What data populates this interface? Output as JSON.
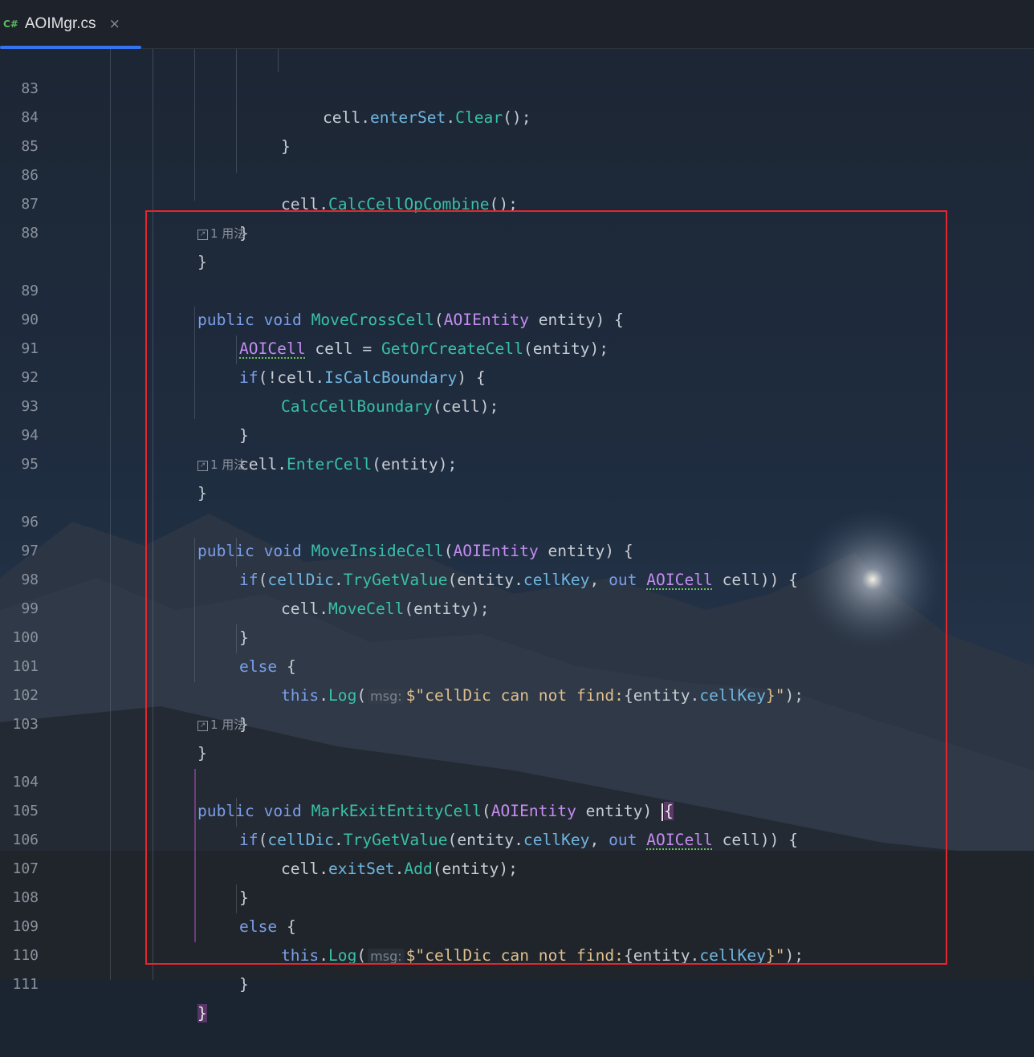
{
  "tab": {
    "language_badge": "C#",
    "title": "AOIMgr.cs",
    "close_icon": "×"
  },
  "editor": {
    "usage_label": "1 用法",
    "hint_label": "msg:",
    "line_numbers": {
      "l83": "83",
      "l84": "84",
      "l85": "85",
      "l86": "86",
      "l87": "87",
      "l88": "88",
      "l89": "89",
      "l90": "90",
      "l91": "91",
      "l92": "92",
      "l93": "93",
      "l94": "94",
      "l95": "95",
      "l96": "96",
      "l97": "97",
      "l98": "98",
      "l99": "99",
      "l100": "100",
      "l101": "101",
      "l102": "102",
      "l103": "103",
      "l104": "104",
      "l105": "105",
      "l106": "106",
      "l107": "107",
      "l108": "108",
      "l109": "109",
      "l110": "110",
      "l111": "111"
    },
    "tokens": {
      "cell": "cell",
      "entity": "entity",
      "this": "this",
      "Log": "Log",
      "public": "public",
      "void": "void",
      "if": "if",
      "else": "else",
      "out": "out",
      "AOIEntity": "AOIEntity",
      "AOICell": "AOICell",
      "cellDic": "cellDic",
      "cellKey": "cellKey",
      "TryGetValue": "TryGetValue",
      "enterSet": "enterSet",
      "Clear": "Clear",
      "CalcCellOpCombine": "CalcCellOpCombine",
      "MoveCrossCell": "MoveCrossCell",
      "GetOrCreateCell": "GetOrCreateCell",
      "IsCalcBoundary": "IsCalcBoundary",
      "CalcCellBoundary": "CalcCellBoundary",
      "EnterCell": "EnterCell",
      "MoveInsideCell": "MoveInsideCell",
      "MoveCell": "MoveCell",
      "MarkExitEntityCell": "MarkExitEntityCell",
      "exitSet": "exitSet",
      "Add": "Add",
      "str_prefix": "$\"cellDic can not find:",
      "str_suffix": "}\""
    }
  },
  "colors": {
    "keyword": "#7a9ee9",
    "method": "#39c0a8",
    "type": "#c48cf0",
    "property": "#70b6e0",
    "string": "#dfbf8c",
    "highlight_box": "#e5262d",
    "tab_underline": "#3574f0"
  }
}
